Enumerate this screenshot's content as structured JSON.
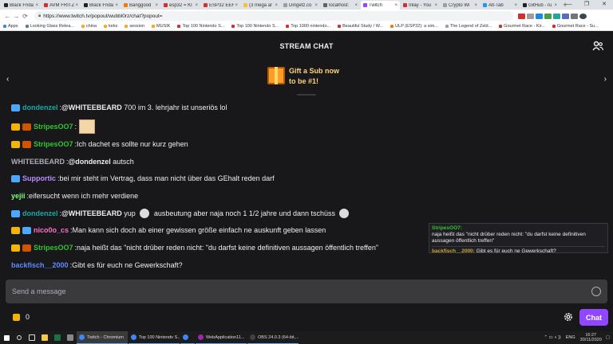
{
  "browser": {
    "tabs": [
      {
        "label": "Black Frida",
        "color": "#222222"
      },
      {
        "label": "AVM FRITZ!",
        "color": "#d32f2f"
      },
      {
        "label": "Black Frida",
        "color": "#222222"
      },
      {
        "label": "Banggood",
        "color": "#f57c00"
      },
      {
        "label": "esp32 = Kl",
        "color": "#d32f2f"
      },
      {
        "label": "ESP32 EEH",
        "color": "#d32f2f"
      },
      {
        "label": "(3 mega ar",
        "color": "#fbc02d"
      },
      {
        "label": "Dingetz.co",
        "color": "#9e9e9e"
      },
      {
        "label": "localhost:",
        "color": "#616161"
      },
      {
        "label": "Twitch",
        "color": "#9147ff",
        "active": true
      },
      {
        "label": "Inlay - You",
        "color": "#d32f2f"
      },
      {
        "label": "Crypto Wi",
        "color": "#9e9e9e"
      },
      {
        "label": "Alt-Tab",
        "color": "#2196f3"
      },
      {
        "label": "GitHub - ru",
        "color": "#222222"
      }
    ],
    "new_tab": "+",
    "window_controls": [
      "—",
      "❐",
      "✕"
    ],
    "url": "https://www.twitch.tv/popout/wubbl0rz/chat?popout=",
    "bookmarks": [
      {
        "label": "Apps",
        "color": "#4285f4"
      },
      {
        "label": "Looking Glass Relea...",
        "color": "#607d8b"
      },
      {
        "label": "china",
        "color": "#f9a825"
      },
      {
        "label": "keks",
        "color": "#f9a825"
      },
      {
        "label": "session",
        "color": "#f9a825"
      },
      {
        "label": "MUSIK",
        "color": "#f9a825"
      },
      {
        "label": "Top 100 Nintendo S...",
        "color": "#d32f2f"
      },
      {
        "label": "Top 100 Nintendo S...",
        "color": "#d32f2f"
      },
      {
        "label": "Top 1000 nintendo...",
        "color": "#d32f2f"
      },
      {
        "label": "Beautiful Study / W...",
        "color": "#d32f2f"
      },
      {
        "label": "ULP (ESP32): a sim...",
        "color": "#f57c00"
      },
      {
        "label": "The Legend of Zeld...",
        "color": "#9e9e9e"
      },
      {
        "label": "Gourmet Race - Kir...",
        "color": "#d32f2f"
      },
      {
        "label": "Gourmet Race - Su...",
        "color": "#d32f2f"
      }
    ]
  },
  "chat": {
    "title": "STREAM CHAT",
    "banner": {
      "line1": "Gift a Sub now",
      "line2": "to be #1!"
    },
    "messages": [
      {
        "badges": [
          "crown"
        ],
        "user": "dondenzel",
        "user_color": "#1aa9a0",
        "text": "@WHITEEBEARD 700 im 3. lehrjahr ist unseriös lol",
        "mention": "@WHITEEBEARD",
        "rest": " 700 im 3. lehrjahr ist unseriös lol"
      },
      {
        "badges": [
          "king",
          "sub"
        ],
        "user": "StripesOO7",
        "user_color": "#31c331",
        "text": ""
      },
      {
        "badges": [
          "king",
          "sub"
        ],
        "user": "StripesOO7",
        "user_color": "#31c331",
        "text": "Ich dachet es sollte nur kurz gehen"
      },
      {
        "badges": [],
        "user": "WHITEEBEARD",
        "user_color": "#adadb8",
        "mention": "@dondenzel",
        "rest": " autsch"
      },
      {
        "badges": [
          "crown"
        ],
        "user": "Supportic",
        "user_color": "#b98bff",
        "text": "bei mir steht im Vertrag, dass man nicht über das GEhalt reden darf"
      },
      {
        "badges": [],
        "user": "yejii",
        "user_color": "#7dff7d",
        "text": "eifersucht wenn ich mehr verdiene"
      },
      {
        "badges": [
          "crown"
        ],
        "user": "dondenzel",
        "user_color": "#1aa9a0",
        "mention": "@WHITEEBEARD",
        "rest1": " yup ",
        "rest2": " ausbeutung aber naja noch 1 1/2 jahre und dann tschüss "
      },
      {
        "badges": [
          "king",
          "crown"
        ],
        "user": "nico0o_cs",
        "user_color": "#ff6ec7",
        "text": "Man kann sich doch ab einer gewissen größe einfach ne auskunft geben lassen"
      },
      {
        "badges": [
          "king",
          "sub"
        ],
        "user": "StripesOO7",
        "user_color": "#31c331",
        "text": "naja heißt das \"nicht drüber reden nicht: \"du darfst keine definitiven aussagen öffentlich treffen\""
      },
      {
        "badges": [],
        "user": "backfisch__2000",
        "user_color": "#5c8cff",
        "text": "Gibt es für euch ne Gewerkschaft?"
      }
    ],
    "popup": {
      "user1": "StripesOO7:",
      "text1": "naja heißt das \"nicht drüber reden nicht: \"du darfst keine definitiven aussagen öffentlich treffen\"",
      "user2": "backfisch__2000:",
      "text2": "Gibt es für euch ne Gewerkschaft?"
    },
    "input_placeholder": "Send a message",
    "points": "0",
    "chat_button": "Chat"
  },
  "taskbar": {
    "apps": [
      {
        "label": "Twitch - Chromium",
        "color": "#4285f4",
        "active": true
      },
      {
        "label": "Top 100 Nintendo S...",
        "color": "#4285f4"
      },
      {
        "label": "",
        "color": "#4285f4"
      },
      {
        "label": "WebApplication11...",
        "color": "#9c27b0"
      },
      {
        "label": "OBS 24.0.3 (64-bit,...",
        "color": "#424242"
      }
    ],
    "lang": "ENG",
    "time": "16:27",
    "date": "30/11/2020"
  }
}
